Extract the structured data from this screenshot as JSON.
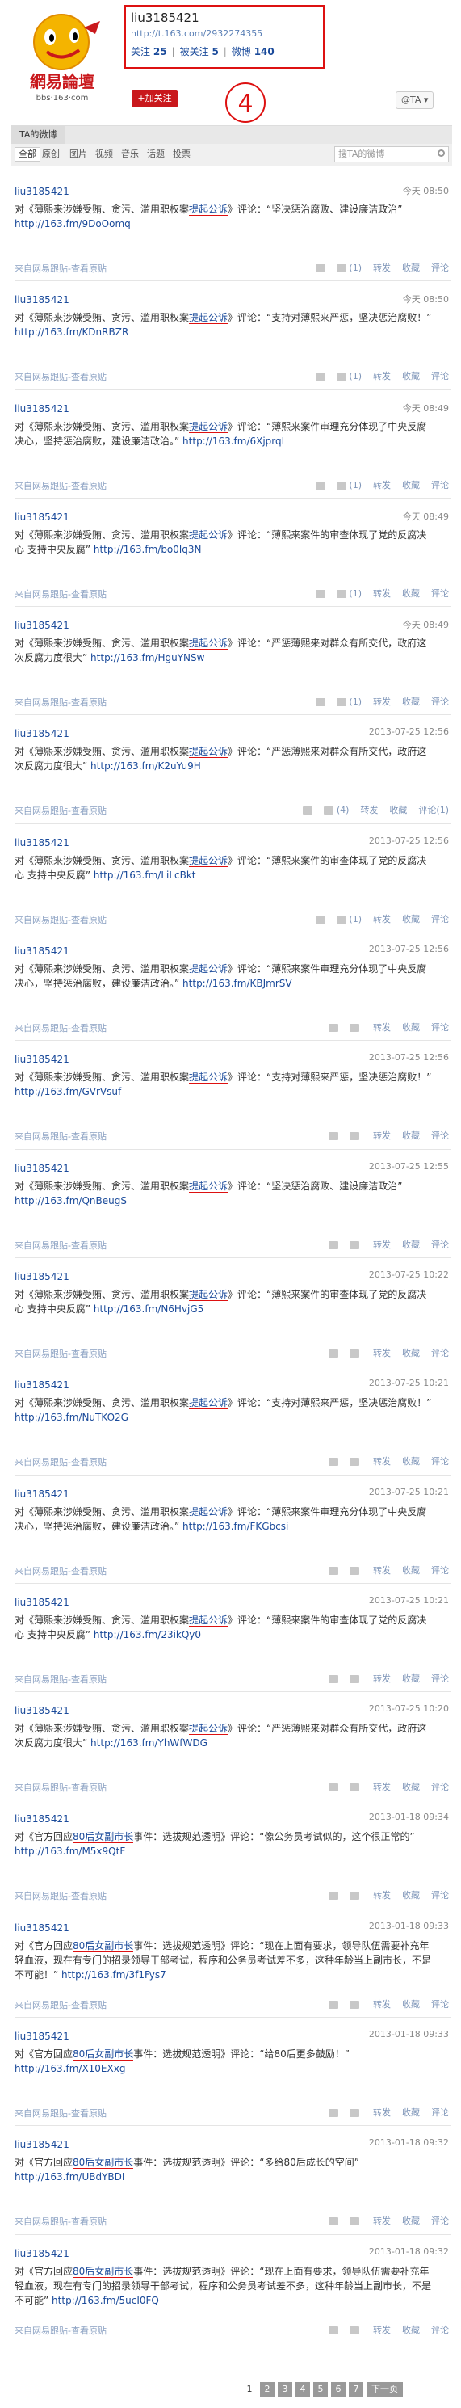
{
  "logo": {
    "brand": "網易論壇",
    "url": "bbs·163·com"
  },
  "profile": {
    "name": "liu3185421",
    "url": "http://t.163.com/2932274355",
    "stats": [
      {
        "label": "关注",
        "value": "25"
      },
      {
        "label": "被关注",
        "value": "5"
      },
      {
        "label": "微博",
        "value": "140"
      }
    ]
  },
  "follow_button": "+加关注",
  "annotation_number": "4",
  "at_button": "@TA",
  "tab_title": "TA的微博",
  "filters": [
    "全部",
    "原创",
    "图片",
    "视频",
    "音乐",
    "话题",
    "投票"
  ],
  "search_placeholder": "搜TA的微博",
  "posts": [
    {
      "user": "liu3185421",
      "time": "今天 08:50",
      "text": "对《薄熙来涉嫌受贿、贪污、滥用职权案",
      "hl": "提起公诉",
      "text2": "》评论：“坚决惩治腐败、建设廉洁政治”",
      "link": "http://163.fm/9DoOomq",
      "source": "来自网易跟贴-查看原贴",
      "likes": "",
      "comments_n": "(1)",
      "forward": "转发",
      "collect": "收藏",
      "comment": "评论"
    },
    {
      "user": "liu3185421",
      "time": "今天 08:50",
      "text": "对《薄熙来涉嫌受贿、贪污、滥用职权案",
      "hl": "提起公诉",
      "text2": "》评论：“支持对薄熙来严惩，坚决惩治腐败！”",
      "link": "http://163.fm/KDnRBZR",
      "source": "来自网易跟贴-查看原贴",
      "likes": "",
      "comments_n": "(1)",
      "forward": "转发",
      "collect": "收藏",
      "comment": "评论"
    },
    {
      "user": "liu3185421",
      "time": "今天 08:49",
      "text": "对《薄熙来涉嫌受贿、贪污、滥用职权案",
      "hl": "提起公诉",
      "text2": "》评论：“薄熙来案件审理充分体现了中央反腐决心，坚持惩治腐败，建设廉洁政治。”",
      "link": "http://163.fm/6XjprqI",
      "source": "来自网易跟贴-查看原贴",
      "likes": "",
      "comments_n": "(1)",
      "forward": "转发",
      "collect": "收藏",
      "comment": "评论"
    },
    {
      "user": "liu3185421",
      "time": "今天 08:49",
      "text": "对《薄熙来涉嫌受贿、贪污、滥用职权案",
      "hl": "提起公诉",
      "text2": "》评论：“薄熙来案件的审查体现了党的反腐决心 支持中央反腐”",
      "link": "http://163.fm/bo0lq3N",
      "source": "来自网易跟贴-查看原贴",
      "likes": "",
      "comments_n": "(1)",
      "forward": "转发",
      "collect": "收藏",
      "comment": "评论"
    },
    {
      "user": "liu3185421",
      "time": "今天 08:49",
      "text": "对《薄熙来涉嫌受贿、贪污、滥用职权案",
      "hl": "提起公诉",
      "text2": "》评论：“严惩薄熙来对群众有所交代，政府这次反腐力度很大”",
      "link": "http://163.fm/HguYNSw",
      "source": "来自网易跟贴-查看原贴",
      "likes": "",
      "comments_n": "(1)",
      "forward": "转发",
      "collect": "收藏",
      "comment": "评论"
    },
    {
      "user": "liu3185421",
      "time": "2013-07-25 12:56",
      "text": "对《薄熙来涉嫌受贿、贪污、滥用职权案",
      "hl": "提起公诉",
      "text2": "》评论：“严惩薄熙来对群众有所交代，政府这次反腐力度很大”",
      "link": "http://163.fm/K2uYu9H",
      "source": "来自网易跟贴-查看原贴",
      "likes": "",
      "comments_n": "(4)",
      "forward": "转发",
      "collect": "收藏",
      "comment": "评论(1)"
    },
    {
      "user": "liu3185421",
      "time": "2013-07-25 12:56",
      "text": "对《薄熙来涉嫌受贿、贪污、滥用职权案",
      "hl": "提起公诉",
      "text2": "》评论：“薄熙来案件的审查体现了党的反腐决心 支持中央反腐”",
      "link": "http://163.fm/LiLcBkt",
      "source": "来自网易跟贴-查看原贴",
      "likes": "",
      "comments_n": "(1)",
      "forward": "转发",
      "collect": "收藏",
      "comment": "评论"
    },
    {
      "user": "liu3185421",
      "time": "2013-07-25 12:56",
      "text": "对《薄熙来涉嫌受贿、贪污、滥用职权案",
      "hl": "提起公诉",
      "text2": "》评论：“薄熙来案件审理充分体现了中央反腐决心，坚持惩治腐败，建设廉洁政治。”",
      "link": "http://163.fm/KBJmrSV",
      "source": "来自网易跟贴-查看原贴",
      "likes": "",
      "comments_n": "",
      "forward": "转发",
      "collect": "收藏",
      "comment": "评论"
    },
    {
      "user": "liu3185421",
      "time": "2013-07-25 12:56",
      "text": "对《薄熙来涉嫌受贿、贪污、滥用职权案",
      "hl": "提起公诉",
      "text2": "》评论：“支持对薄熙来严惩，坚决惩治腐败！”",
      "link": "http://163.fm/GVrVsuf",
      "source": "来自网易跟贴-查看原贴",
      "likes": "",
      "comments_n": "",
      "forward": "转发",
      "collect": "收藏",
      "comment": "评论"
    },
    {
      "user": "liu3185421",
      "time": "2013-07-25 12:55",
      "text": "对《薄熙来涉嫌受贿、贪污、滥用职权案",
      "hl": "提起公诉",
      "text2": "》评论：“坚决惩治腐败、建设廉洁政治”",
      "link": "http://163.fm/QnBeugS",
      "source": "来自网易跟贴-查看原贴",
      "likes": "",
      "comments_n": "",
      "forward": "转发",
      "collect": "收藏",
      "comment": "评论"
    },
    {
      "user": "liu3185421",
      "time": "2013-07-25 10:22",
      "text": "对《薄熙来涉嫌受贿、贪污、滥用职权案",
      "hl": "提起公诉",
      "text2": "》评论：“薄熙来案件的审查体现了党的反腐决心 支持中央反腐”",
      "link": "http://163.fm/N6HvjG5",
      "source": "来自网易跟贴-查看原贴",
      "likes": "",
      "comments_n": "",
      "forward": "转发",
      "collect": "收藏",
      "comment": "评论"
    },
    {
      "user": "liu3185421",
      "time": "2013-07-25 10:21",
      "text": "对《薄熙来涉嫌受贿、贪污、滥用职权案",
      "hl": "提起公诉",
      "text2": "》评论：“支持对薄熙来严惩，坚决惩治腐败！”",
      "link": "http://163.fm/NuTKO2G",
      "source": "来自网易跟贴-查看原贴",
      "likes": "",
      "comments_n": "",
      "forward": "转发",
      "collect": "收藏",
      "comment": "评论"
    },
    {
      "user": "liu3185421",
      "time": "2013-07-25 10:21",
      "text": "对《薄熙来涉嫌受贿、贪污、滥用职权案",
      "hl": "提起公诉",
      "text2": "》评论：“薄熙来案件审理充分体现了中央反腐决心，坚持惩治腐败，建设廉洁政治。”",
      "link": "http://163.fm/FKGbcsi",
      "source": "来自网易跟贴-查看原贴",
      "likes": "",
      "comments_n": "",
      "forward": "转发",
      "collect": "收藏",
      "comment": "评论"
    },
    {
      "user": "liu3185421",
      "time": "2013-07-25 10:21",
      "text": "对《薄熙来涉嫌受贿、贪污、滥用职权案",
      "hl": "提起公诉",
      "text2": "》评论：“薄熙来案件的审查体现了党的反腐决心 支持中央反腐”",
      "link": "http://163.fm/23ikQy0",
      "source": "来自网易跟贴-查看原贴",
      "likes": "",
      "comments_n": "",
      "forward": "转发",
      "collect": "收藏",
      "comment": "评论"
    },
    {
      "user": "liu3185421",
      "time": "2013-07-25 10:20",
      "text": "对《薄熙来涉嫌受贿、贪污、滥用职权案",
      "hl": "提起公诉",
      "text2": "》评论：“严惩薄熙来对群众有所交代，政府这次反腐力度很大”",
      "link": "http://163.fm/YhWfWDG",
      "source": "来自网易跟贴-查看原贴",
      "likes": "",
      "comments_n": "",
      "forward": "转发",
      "collect": "收藏",
      "comment": "评论"
    },
    {
      "user": "liu3185421",
      "time": "2013-01-18 09:34",
      "text": "对《官方回应",
      "hl": "80后女副市长",
      "text2": "事件：选拔规范透明》评论：“像公务员考试似的，这个很正常的”",
      "link": "http://163.fm/M5x9QtF",
      "source": "来自网易跟贴-查看原贴",
      "likes": "",
      "comments_n": "",
      "forward": "转发",
      "collect": "收藏",
      "comment": "评论"
    },
    {
      "user": "liu3185421",
      "time": "2013-01-18 09:33",
      "text": "对《官方回应",
      "hl": "80后女副市长",
      "text2": "事件：选拔规范透明》评论：“现在上面有要求，领导队伍需要补充年轻血液，现在有专门的招录领导干部考试，程序和公务员考试差不多，这种年龄当上副市长，不是不可能！”",
      "link": "http://163.fm/3f1Fys7",
      "source": "来自网易跟贴-查看原贴",
      "likes": "",
      "comments_n": "",
      "forward": "转发",
      "collect": "收藏",
      "comment": "评论"
    },
    {
      "user": "liu3185421",
      "time": "2013-01-18 09:33",
      "text": "对《官方回应",
      "hl": "80后女副市长",
      "text2": "事件：选拔规范透明》评论：“给80后更多鼓励！”",
      "link": "http://163.fm/X10EXxg",
      "source": "来自网易跟贴-查看原贴",
      "likes": "",
      "comments_n": "",
      "forward": "转发",
      "collect": "收藏",
      "comment": "评论"
    },
    {
      "user": "liu3185421",
      "time": "2013-01-18 09:32",
      "text": "对《官方回应",
      "hl": "80后女副市长",
      "text2": "事件：选拔规范透明》评论：“多给80后成长的空间”",
      "link": "http://163.fm/UBdYBDI",
      "source": "来自网易跟贴-查看原贴",
      "likes": "",
      "comments_n": "",
      "forward": "转发",
      "collect": "收藏",
      "comment": "评论"
    },
    {
      "user": "liu3185421",
      "time": "2013-01-18 09:32",
      "text": "对《官方回应",
      "hl": "80后女副市长",
      "text2": "事件：选拔规范透明》评论：“现在上面有要求，领导队伍需要补充年轻血液，现在有专门的招录领导干部考试，程序和公务员考试差不多，这种年龄当上副市长，不是不可能”",
      "link": "http://163.fm/5ucI0FQ",
      "source": "来自网易跟贴-查看原贴",
      "likes": "",
      "comments_n": "",
      "forward": "转发",
      "collect": "收藏",
      "comment": "评论"
    }
  ],
  "pager": {
    "current": "1",
    "pages": [
      "2",
      "3",
      "4",
      "5",
      "6",
      "7"
    ],
    "next": "下一页"
  }
}
